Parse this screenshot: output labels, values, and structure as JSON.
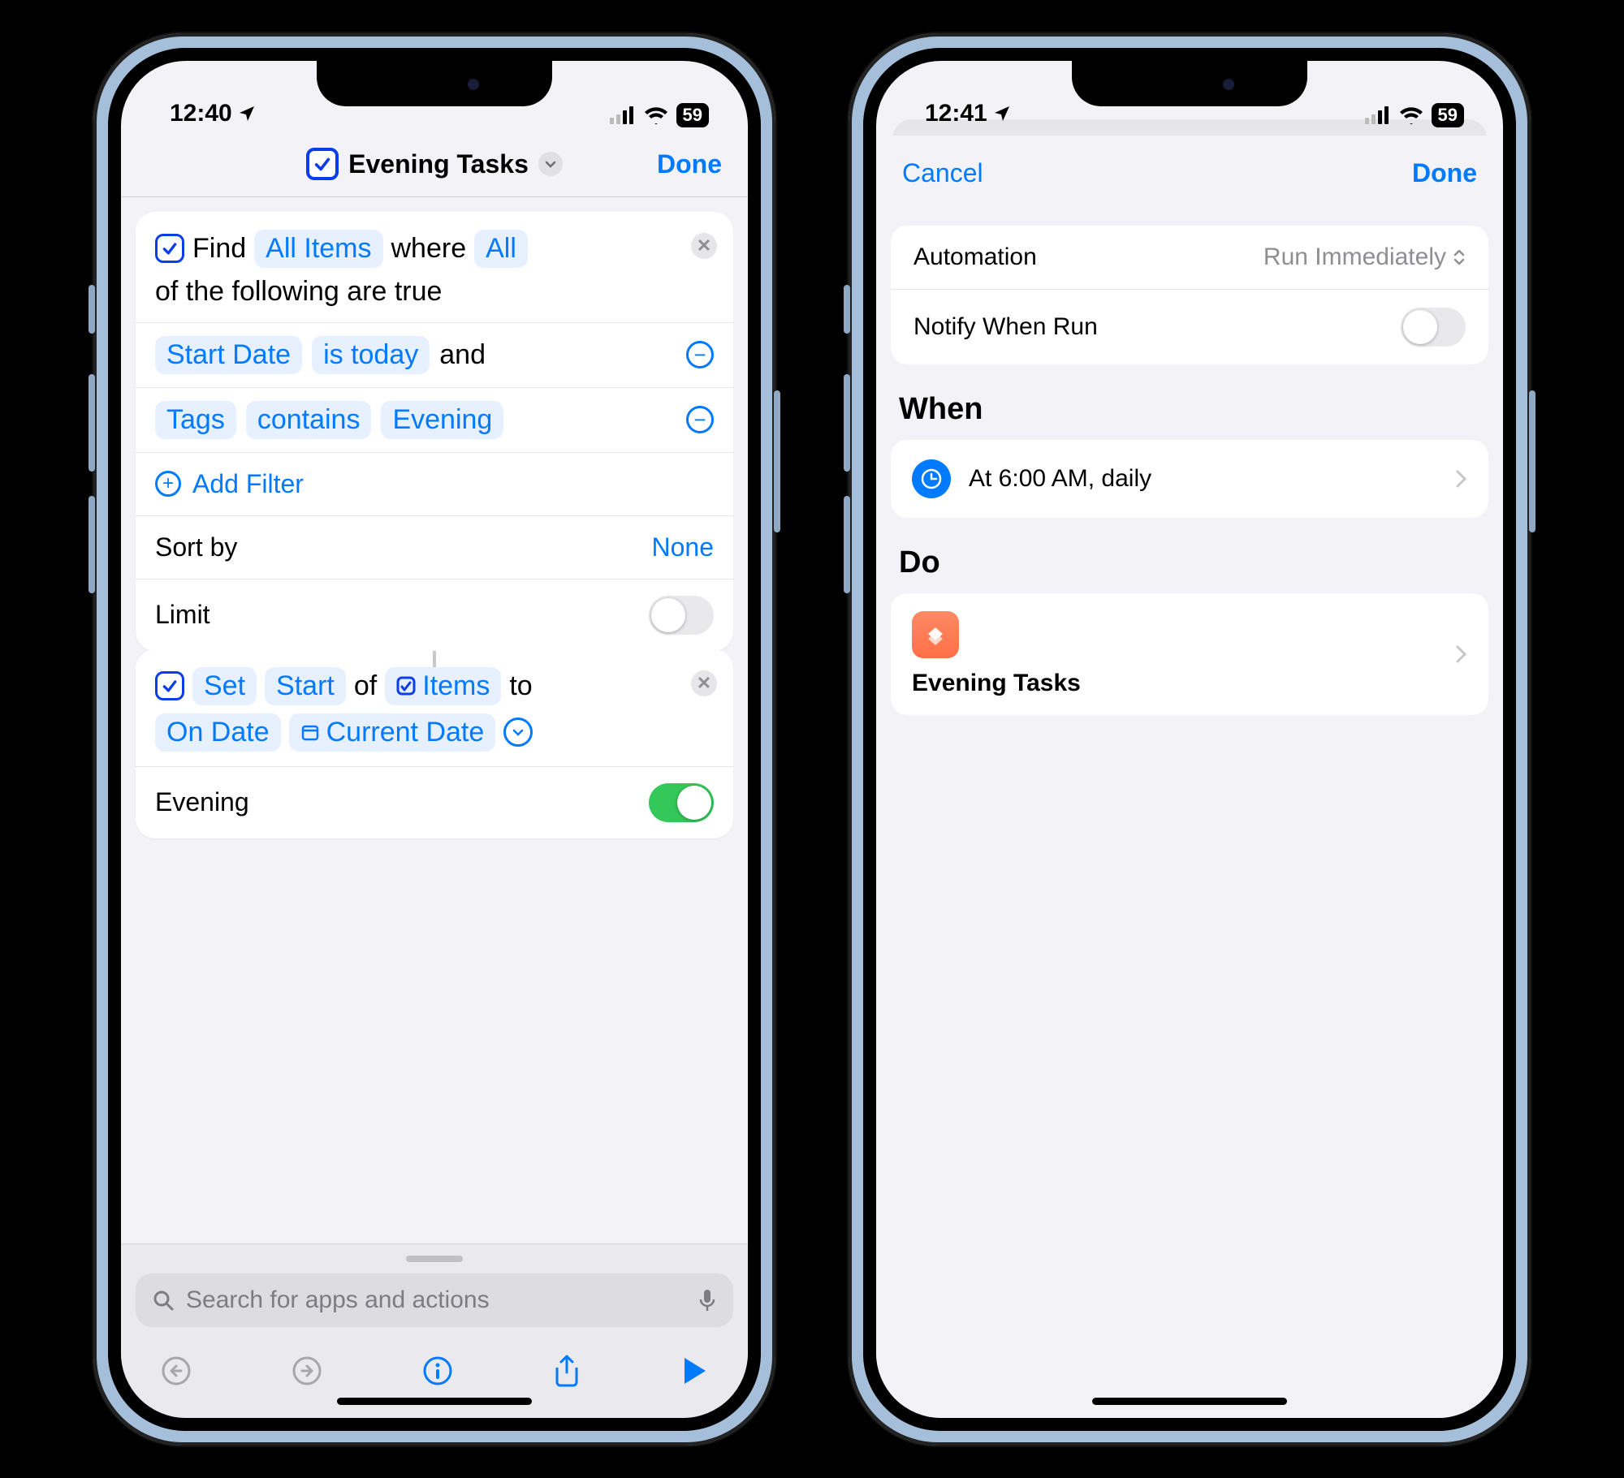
{
  "phoneA": {
    "status": {
      "time": "12:40",
      "battery": "59"
    },
    "nav": {
      "title": "Evening Tasks",
      "done": "Done"
    },
    "find": {
      "verb": "Find",
      "subject": "All Items",
      "where": "where",
      "qualifier": "All",
      "suffix": "of the following are true"
    },
    "criteria": [
      {
        "field": "Start Date",
        "op": "is today",
        "joiner": "and"
      },
      {
        "field": "Tags",
        "op": "contains",
        "value": "Evening"
      }
    ],
    "addFilter": "Add Filter",
    "sortBy": {
      "label": "Sort by",
      "value": "None"
    },
    "limit": {
      "label": "Limit",
      "on": false
    },
    "set": {
      "verb": "Set",
      "prop": "Start",
      "of": "of",
      "target": "Items",
      "to": "to",
      "mode": "On Date",
      "dateToken": "Current Date"
    },
    "eveningRow": {
      "label": "Evening",
      "on": true
    },
    "search": {
      "placeholder": "Search for apps and actions"
    }
  },
  "phoneB": {
    "status": {
      "time": "12:41",
      "battery": "59"
    },
    "nav": {
      "cancel": "Cancel",
      "done": "Done"
    },
    "automation": {
      "label": "Automation",
      "value": "Run Immediately"
    },
    "notify": {
      "label": "Notify When Run",
      "on": false
    },
    "when": {
      "heading": "When",
      "text": "At 6:00 AM, daily"
    },
    "do": {
      "heading": "Do",
      "shortcut": "Evening Tasks"
    }
  }
}
